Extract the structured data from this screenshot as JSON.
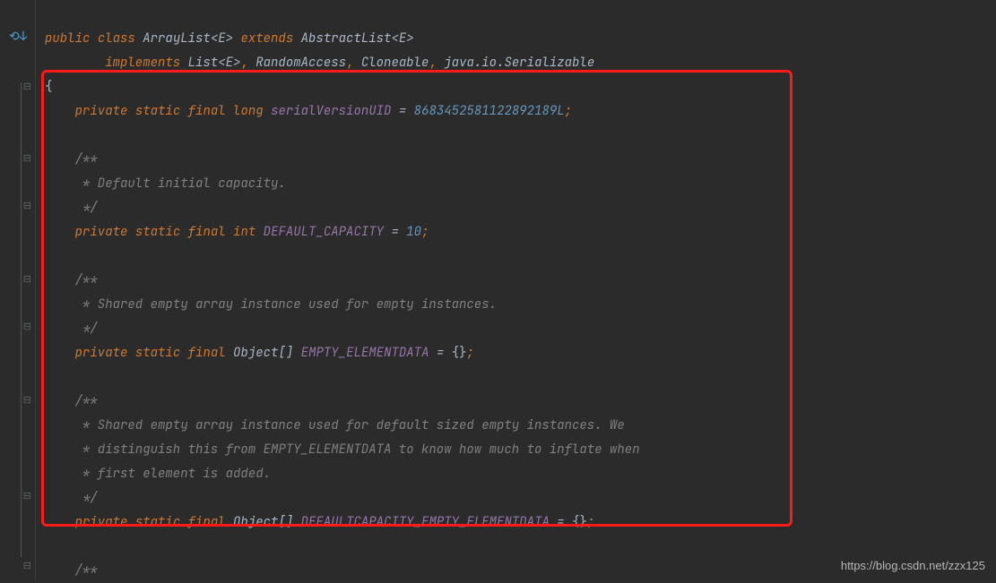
{
  "code": {
    "line1": {
      "kw_public": "public",
      "kw_class": "class",
      "classname": "ArrayList",
      "generic": "<E>",
      "kw_extends": "extends",
      "parent": "AbstractList",
      "parent_generic": "<E>"
    },
    "line2": {
      "kw_implements": "implements",
      "iface1": "List",
      "iface1_generic": "<E>",
      "iface2": "RandomAccess",
      "iface3": "Cloneable",
      "iface4": "java.io.Serializable"
    },
    "line3": {
      "brace": "{"
    },
    "line4": {
      "kw_private": "private",
      "kw_static": "static",
      "kw_final": "final",
      "kw_type": "long",
      "field": "serialVersionUID",
      "op": " = ",
      "value": "8683452581122892189L",
      "semi": ";"
    },
    "line6": {
      "c": "/**"
    },
    "line7": {
      "c": " * Default initial capacity."
    },
    "line8": {
      "c": " */"
    },
    "line9": {
      "kw_private": "private",
      "kw_static": "static",
      "kw_final": "final",
      "kw_type": "int",
      "field": "DEFAULT_CAPACITY",
      "op": " = ",
      "value": "10",
      "semi": ";"
    },
    "line11": {
      "c": "/**"
    },
    "line12": {
      "c": " * Shared empty array instance used for empty instances."
    },
    "line13": {
      "c": " */"
    },
    "line14": {
      "kw_private": "private",
      "kw_static": "static",
      "kw_final": "final",
      "kw_type": "Object",
      "arr": "[]",
      "field": "EMPTY_ELEMENTDATA",
      "op": " = ",
      "value": "{}",
      "semi": ";"
    },
    "line16": {
      "c": "/**"
    },
    "line17": {
      "c": " * Shared empty array instance used for default sized empty instances. We"
    },
    "line18": {
      "c": " * distinguish this from EMPTY_ELEMENTDATA to know how much to inflate when"
    },
    "line19": {
      "c": " * first element is added."
    },
    "line20": {
      "c": " */"
    },
    "line21": {
      "kw_private": "private",
      "kw_static": "static",
      "kw_final": "final",
      "kw_type": "Object",
      "arr": "[]",
      "field": "DEFAULTCAPACITY_EMPTY_ELEMENTDATA",
      "op": " = ",
      "value": "{}",
      "semi": ";"
    },
    "line23": {
      "c": "/**"
    }
  },
  "watermark": "https://blog.csdn.net/zzx125"
}
